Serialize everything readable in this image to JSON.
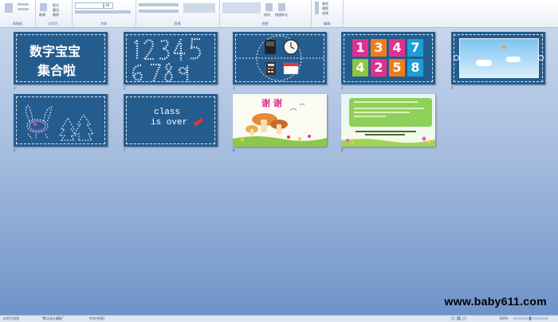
{
  "ribbon": {
    "groups": [
      "剪贴板",
      "幻灯片",
      "字体",
      "段落",
      "绘图",
      "编辑"
    ],
    "font_size": "18",
    "button_labels": [
      "新建",
      "幻灯片",
      "版式",
      "重设",
      "删除",
      "排列",
      "快速样式",
      "查找",
      "替换",
      "选择"
    ]
  },
  "slides": [
    {
      "num": "1",
      "title_line1": "数字宝宝",
      "title_line2": "集合啦"
    },
    {
      "num": "2",
      "content": "12345 6789"
    },
    {
      "num": "3",
      "content": "phone clock calculator calendar"
    },
    {
      "num": "4",
      "digits": [
        "1",
        "3",
        "4",
        "7",
        "4",
        "2",
        "5",
        "8"
      ]
    },
    {
      "num": "5",
      "content": "window"
    },
    {
      "num": "6",
      "content": "rabbit tree"
    },
    {
      "num": "7",
      "text_line1": "class",
      "text_line2": "is over"
    },
    {
      "num": "8",
      "title": "谢 谢"
    },
    {
      "num": "9",
      "content": "notes"
    }
  ],
  "watermark": "www.baby611.com",
  "status": {
    "view": "幻灯片浏览",
    "theme": "\"默认设计模板\"",
    "language": "中文(中国)",
    "zoom": "100%"
  },
  "colors": {
    "slide_blue": "#245c8e",
    "sorter_top": "#c7d5ec",
    "sorter_bottom": "#6f93c8"
  }
}
